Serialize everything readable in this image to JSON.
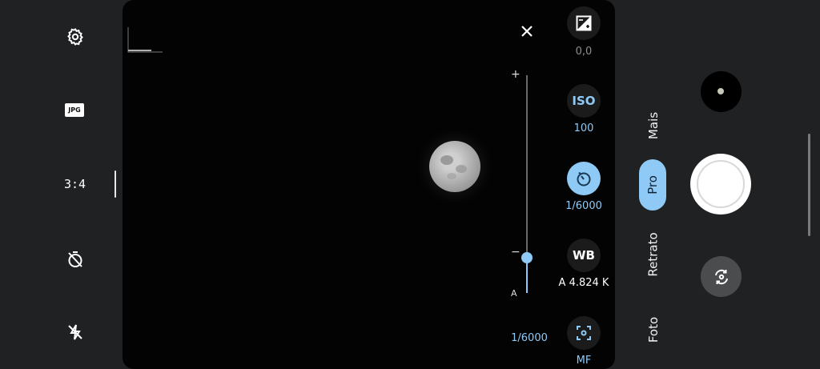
{
  "left_bar": {
    "settings_icon": "gear-icon",
    "format_label": "JPG",
    "ratio_label": "3:4",
    "timer_icon": "timer-off-icon",
    "flash_icon": "flash-off-icon"
  },
  "viewfinder": {
    "close_icon": "close-icon",
    "slider": {
      "plus": "+",
      "minus": "−",
      "auto": "A",
      "value": "1/6000",
      "level": 0.16
    }
  },
  "pro_controls": [
    {
      "id": "ev",
      "icon": "exposure-icon",
      "value": "0,0",
      "active": false
    },
    {
      "id": "iso",
      "icon_text": "ISO",
      "value": "100",
      "active": false
    },
    {
      "id": "shutter",
      "icon": "shutter-icon",
      "value": "1/6000",
      "active": true
    },
    {
      "id": "wb",
      "icon_text": "WB",
      "value": "A 4.824 K",
      "active": false
    },
    {
      "id": "focus",
      "icon": "focus-icon",
      "value": "MF",
      "active": false
    }
  ],
  "modes": {
    "more": "Mais",
    "pro": "Pro",
    "portrait": "Retrato",
    "photo": "Foto"
  },
  "colors": {
    "accent": "#8fcaf7",
    "background": "#1f2123",
    "viewfinder": "#030303"
  }
}
